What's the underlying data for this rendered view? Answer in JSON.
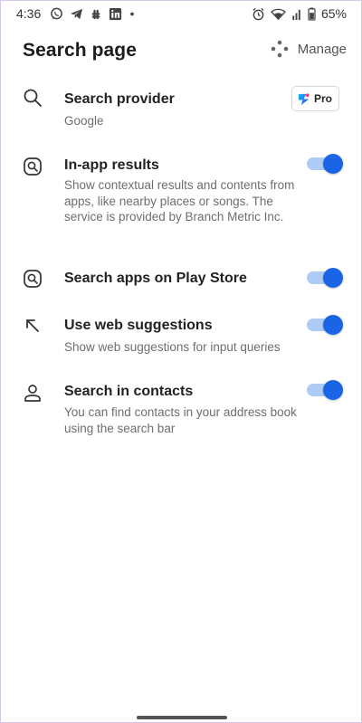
{
  "status_bar": {
    "time": "4:36",
    "battery_percent": "65%",
    "left_icons": [
      "whatsapp-icon",
      "telegram-icon",
      "slack-icon",
      "linkedin-icon",
      "dot-icon"
    ],
    "right_icons": [
      "alarm-icon",
      "wifi-icon",
      "signal-icon",
      "battery-icon"
    ]
  },
  "header": {
    "title": "Search page",
    "manage_label": "Manage"
  },
  "settings": {
    "search_provider": {
      "title": "Search provider",
      "value": "Google",
      "badge_label": "Pro"
    },
    "in_app_results": {
      "title": "In-app results",
      "description": "Show contextual results and contents from apps, like nearby places or songs. The service is provided by Branch Metric Inc.",
      "enabled": true
    },
    "search_play_store": {
      "title": "Search apps on Play Store",
      "enabled": true
    },
    "web_suggestions": {
      "title": "Use web suggestions",
      "description": "Show web suggestions for input queries",
      "enabled": true
    },
    "search_contacts": {
      "title": "Search in contacts",
      "description": "You can find contacts in your address book using the search bar",
      "enabled": true
    }
  },
  "colors": {
    "toggle_on": "#1a64e6",
    "toggle_track": "#aecbf6",
    "title_text": "#1c1c1c",
    "description_text": "#6e6e6e"
  }
}
